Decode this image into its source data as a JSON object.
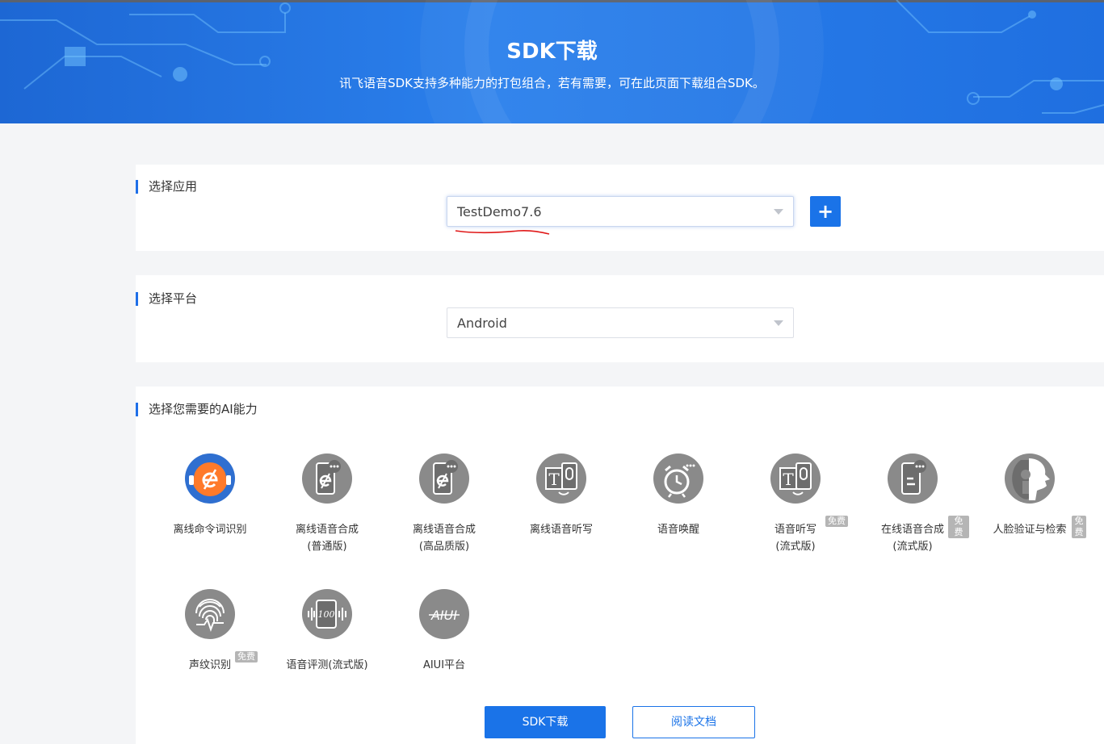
{
  "banner": {
    "title": "SDK下载",
    "subtitle": "讯飞语音SDK支持多种能力的打包组合，若有需要，可在此页面下载组合SDK。"
  },
  "sections": {
    "app": {
      "title": "选择应用",
      "selected": "TestDemo7.6",
      "add_label": "+"
    },
    "platform": {
      "title": "选择平台",
      "selected": "Android"
    },
    "ai": {
      "title": "选择您需要的AI能力"
    }
  },
  "abilities": [
    {
      "line1": "离线命令词识别",
      "line2": "",
      "icon": "offline-command-icon",
      "badge": ""
    },
    {
      "line1": "离线语音合成",
      "line2": "(普通版)",
      "icon": "offline-tts-icon",
      "badge": ""
    },
    {
      "line1": "离线语音合成",
      "line2": "(高品质版)",
      "icon": "offline-tts-hq-icon",
      "badge": ""
    },
    {
      "line1": "离线语音听写",
      "line2": "",
      "icon": "offline-dictation-icon",
      "badge": ""
    },
    {
      "line1": "语音唤醒",
      "line2": "",
      "icon": "wakeup-icon",
      "badge": ""
    },
    {
      "line1": "语音听写",
      "line2": "(流式版)",
      "icon": "dictation-stream-icon",
      "badge": "免费"
    },
    {
      "line1": "在线语音合成",
      "line2": "(流式版)",
      "icon": "online-tts-icon",
      "badge": "免费"
    },
    {
      "line1": "人脸验证与检索",
      "line2": "",
      "icon": "face-verify-icon",
      "badge": "免费"
    },
    {
      "line1": "声纹识别",
      "line2": "",
      "icon": "voiceprint-icon",
      "badge": "免费"
    },
    {
      "line1": "语音评测(流式版)",
      "line2": "",
      "icon": "speech-eval-icon",
      "badge": ""
    },
    {
      "line1": "AIUI平台",
      "line2": "",
      "icon": "aiui-icon",
      "badge": ""
    }
  ],
  "icon_glyphs": {
    "aiui": "AIUI",
    "eval": "100"
  },
  "buttons": {
    "download": "SDK下载",
    "docs": "阅读文档"
  },
  "colors": {
    "accent": "#1a73e8",
    "banner": "#2b80ec",
    "icon_gray": "#8a8a8a",
    "icon_active": "#2f6fd0",
    "badge": "#b5b5b5"
  }
}
